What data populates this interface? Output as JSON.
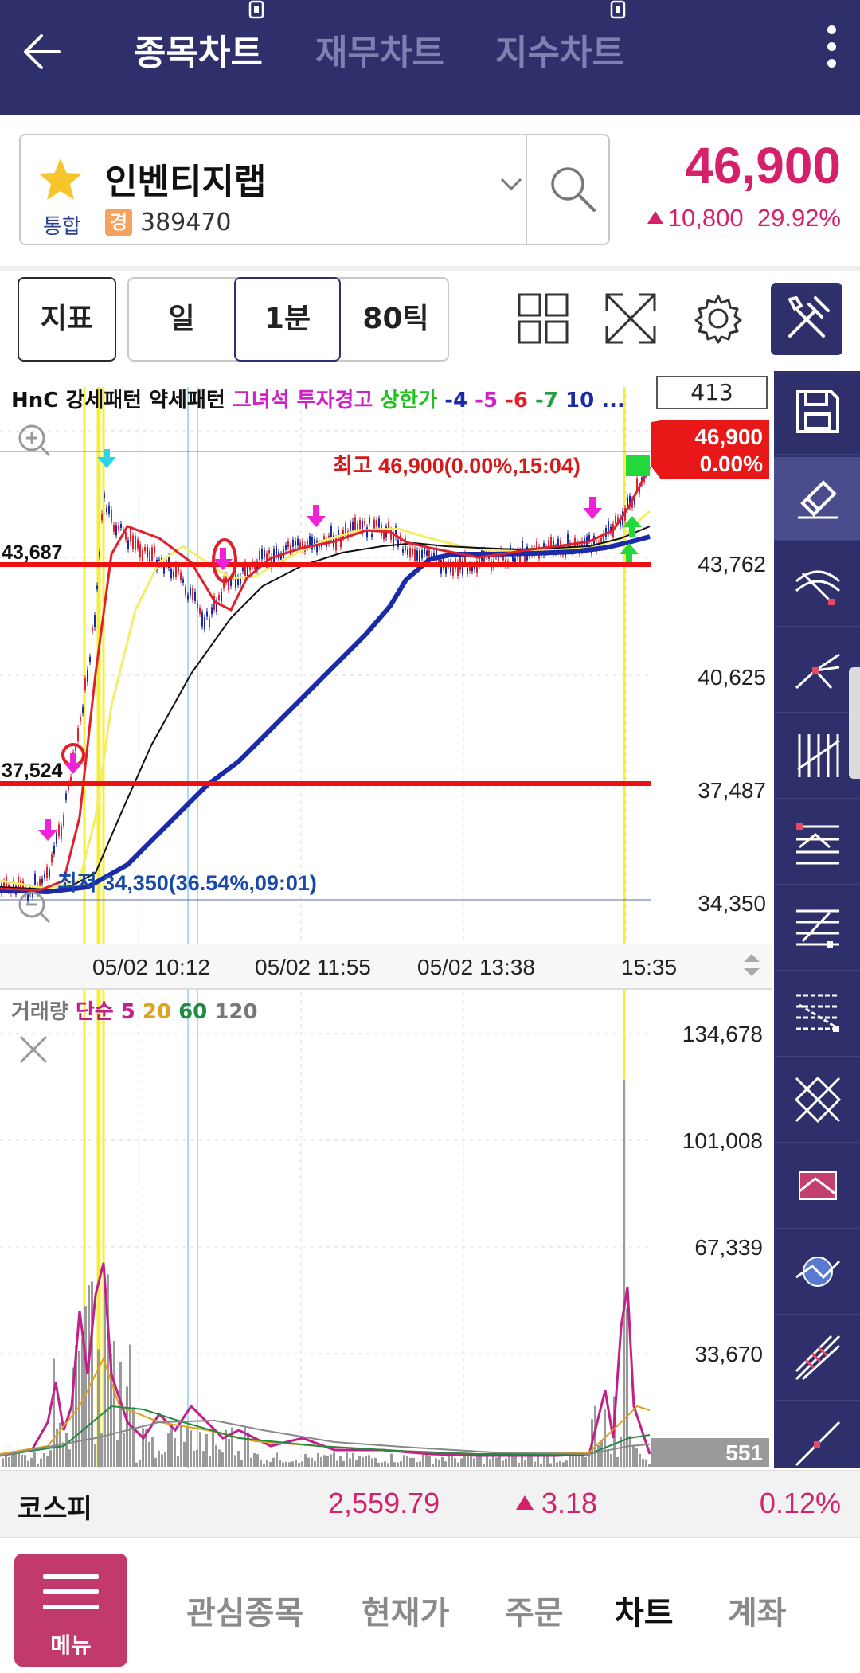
{
  "header": {
    "tabs": [
      {
        "label": "종목차트",
        "active": true
      },
      {
        "label": "재무차트",
        "active": false
      },
      {
        "label": "지수차트",
        "active": false
      }
    ]
  },
  "stock": {
    "name": "인벤티지랩",
    "market": "통합",
    "badge": "경",
    "code": "389470",
    "price": "46,900",
    "change": "10,800",
    "change_rate": "29.92%"
  },
  "toolbar": {
    "indicator_label": "지표",
    "periods": [
      "일",
      "1분",
      "80틱"
    ],
    "selected_period": "1분"
  },
  "chart": {
    "legend": [
      {
        "text": "HnC 강세패턴 약세패턴 ",
        "color": "#111111"
      },
      {
        "text": "그녀석 투자경고 ",
        "color": "#d020c8"
      },
      {
        "text": "상한가 ",
        "color": "#22c020"
      },
      {
        "text": "-4 ",
        "color": "#1a2aa8"
      },
      {
        "text": "-5 ",
        "color": "#d020c8"
      },
      {
        "text": "-6 ",
        "color": "#e0202a"
      },
      {
        "text": "-7 ",
        "color": "#22a040"
      },
      {
        "text": "10 ...",
        "color": "#1a2aa8"
      }
    ],
    "count": "413",
    "current_tag": {
      "price": "46,900",
      "rate": "0.00%"
    },
    "high_note": "최고 46,900(0.00%,15:04)",
    "low_note": "최저 34,350(36.54%,09:01)",
    "hline_labels": [
      "43,687",
      "37,524"
    ],
    "y_axis": [
      "43,762",
      "40,625",
      "37,487",
      "34,350"
    ],
    "x_axis": [
      "05/02 10:12",
      "05/02 11:55",
      "05/02 13:38",
      "15:35"
    ],
    "volume_legend": [
      {
        "text": "거래량 ",
        "color": "#777777"
      },
      {
        "text": "단순 5 ",
        "color": "#c0208a"
      },
      {
        "text": "20 ",
        "color": "#e0a020"
      },
      {
        "text": "60 ",
        "color": "#208a40"
      },
      {
        "text": "120",
        "color": "#777777"
      }
    ],
    "volume_axis": [
      "134,678",
      "101,008",
      "67,339",
      "33,670"
    ],
    "volume_last": "551",
    "colors": {
      "up": "#e0202a",
      "down": "#1a2aa8",
      "hline": "#ee1111",
      "ma_yellow": "#f2ee6a",
      "ma_black": "#111111",
      "ma_blue": "#1a2aa8"
    }
  },
  "index_bar": {
    "name": "코스피",
    "value": "2,559.79",
    "change": "3.18",
    "rate": "0.12%"
  },
  "nav": {
    "menu_label": "메뉴",
    "items": [
      {
        "label": "관심종목",
        "active": false
      },
      {
        "label": "현재가",
        "active": false
      },
      {
        "label": "주문",
        "active": false
      },
      {
        "label": "차트",
        "active": true
      },
      {
        "label": "계좌",
        "active": false
      }
    ]
  }
}
